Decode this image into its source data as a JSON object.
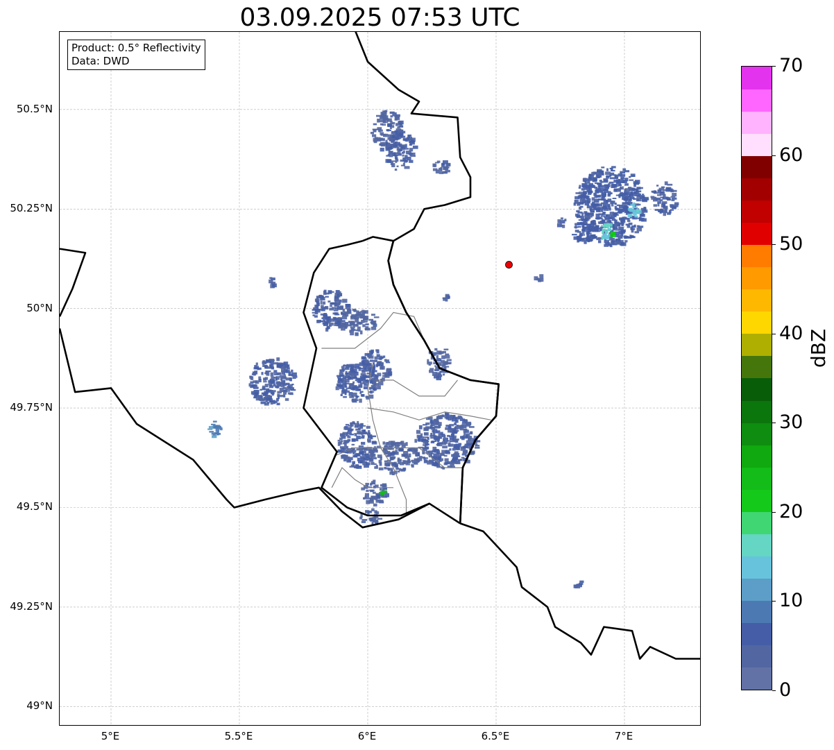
{
  "title": "03.09.2025 07:53 UTC",
  "info": {
    "product": "Product: 0.5° Reflectivity",
    "data": "Data: DWD"
  },
  "map": {
    "lon_range": [
      4.8,
      7.3
    ],
    "lat_range": [
      48.95,
      50.695
    ],
    "lat_ticks": [
      {
        "value": 50.5,
        "label": "50.5°N"
      },
      {
        "value": 50.25,
        "label": "50.25°N"
      },
      {
        "value": 50.0,
        "label": "50°N"
      },
      {
        "value": 49.75,
        "label": "49.75°N"
      },
      {
        "value": 49.5,
        "label": "49.5°N"
      },
      {
        "value": 49.25,
        "label": "49.25°N"
      },
      {
        "value": 49.0,
        "label": "49°N"
      }
    ],
    "lon_ticks": [
      {
        "value": 5.0,
        "label": "5°E"
      },
      {
        "value": 5.5,
        "label": "5.5°E"
      },
      {
        "value": 6.0,
        "label": "6°E"
      },
      {
        "value": 6.5,
        "label": "6.5°E"
      },
      {
        "value": 7.0,
        "label": "7°E"
      }
    ],
    "grid": true,
    "radar_site": {
      "lon": 6.55,
      "lat": 50.11
    },
    "borders": [
      [
        [
          5.95,
          50.7
        ],
        [
          6.0,
          50.62
        ],
        [
          6.12,
          50.55
        ],
        [
          6.2,
          50.52
        ],
        [
          6.17,
          50.49
        ],
        [
          6.35,
          50.48
        ],
        [
          6.36,
          50.38
        ],
        [
          6.4,
          50.33
        ],
        [
          6.4,
          50.28
        ],
        [
          6.3,
          50.26
        ],
        [
          6.22,
          50.25
        ],
        [
          6.18,
          50.2
        ],
        [
          6.1,
          50.17
        ],
        [
          6.08,
          50.12
        ],
        [
          6.1,
          50.06
        ],
        [
          6.15,
          49.99
        ],
        [
          6.22,
          49.92
        ],
        [
          6.28,
          49.85
        ],
        [
          6.4,
          49.82
        ],
        [
          6.51,
          49.81
        ],
        [
          6.5,
          49.73
        ],
        [
          6.42,
          49.67
        ],
        [
          6.37,
          49.6
        ],
        [
          6.36,
          49.46
        ]
      ],
      [
        [
          6.36,
          49.46
        ],
        [
          6.45,
          49.44
        ],
        [
          6.58,
          49.35
        ],
        [
          6.6,
          49.3
        ],
        [
          6.7,
          49.25
        ],
        [
          6.73,
          49.2
        ],
        [
          6.83,
          49.16
        ],
        [
          6.87,
          49.13
        ],
        [
          6.92,
          49.2
        ],
        [
          7.03,
          49.19
        ],
        [
          7.06,
          49.12
        ],
        [
          7.1,
          49.15
        ],
        [
          7.2,
          49.12
        ],
        [
          7.3,
          49.12
        ]
      ],
      [
        [
          6.36,
          49.46
        ],
        [
          6.24,
          49.51
        ],
        [
          6.12,
          49.47
        ],
        [
          5.98,
          49.45
        ],
        [
          5.9,
          49.49
        ],
        [
          5.81,
          49.55
        ],
        [
          5.73,
          49.54
        ],
        [
          5.6,
          49.52
        ],
        [
          5.48,
          49.5
        ],
        [
          5.45,
          49.52
        ],
        [
          5.32,
          49.62
        ],
        [
          5.1,
          49.71
        ],
        [
          5.0,
          49.8
        ],
        [
          4.86,
          49.79
        ],
        [
          4.8,
          49.95
        ]
      ],
      [
        [
          4.8,
          50.15
        ],
        [
          4.9,
          50.14
        ],
        [
          4.85,
          50.05
        ],
        [
          4.8,
          49.98
        ]
      ],
      [
        [
          5.98,
          50.17
        ],
        [
          5.92,
          50.16
        ],
        [
          5.85,
          50.15
        ],
        [
          5.79,
          50.09
        ],
        [
          5.75,
          49.99
        ],
        [
          5.8,
          49.9
        ],
        [
          5.75,
          49.75
        ],
        [
          5.88,
          49.64
        ],
        [
          5.82,
          49.55
        ],
        [
          5.92,
          49.5
        ],
        [
          6.0,
          49.48
        ],
        [
          6.13,
          49.48
        ],
        [
          6.24,
          49.51
        ]
      ],
      [
        [
          6.36,
          49.46
        ],
        [
          6.37,
          49.6
        ],
        [
          6.42,
          49.67
        ],
        [
          6.5,
          49.73
        ],
        [
          6.51,
          49.81
        ],
        [
          6.4,
          49.82
        ],
        [
          6.28,
          49.85
        ],
        [
          6.22,
          49.92
        ],
        [
          6.15,
          49.99
        ],
        [
          6.1,
          50.06
        ],
        [
          6.08,
          50.12
        ],
        [
          6.1,
          50.17
        ],
        [
          6.02,
          50.18
        ],
        [
          5.98,
          50.17
        ]
      ]
    ],
    "admin_lines": [
      [
        [
          5.82,
          49.9
        ],
        [
          5.95,
          49.9
        ],
        [
          6.05,
          49.95
        ],
        [
          6.1,
          49.99
        ],
        [
          6.18,
          49.98
        ],
        [
          6.22,
          49.92
        ]
      ],
      [
        [
          6.03,
          49.82
        ],
        [
          6.1,
          49.82
        ],
        [
          6.2,
          49.78
        ],
        [
          6.3,
          49.78
        ],
        [
          6.35,
          49.82
        ]
      ],
      [
        [
          6.0,
          49.75
        ],
        [
          6.1,
          49.74
        ],
        [
          6.2,
          49.72
        ],
        [
          6.3,
          49.74
        ],
        [
          6.4,
          49.73
        ],
        [
          6.48,
          49.72
        ]
      ],
      [
        [
          6.02,
          49.86
        ],
        [
          6.0,
          49.8
        ],
        [
          6.02,
          49.72
        ],
        [
          6.05,
          49.65
        ],
        [
          6.1,
          49.6
        ],
        [
          6.15,
          49.52
        ],
        [
          6.15,
          49.48
        ]
      ],
      [
        [
          5.87,
          49.63
        ],
        [
          5.95,
          49.65
        ],
        [
          6.05,
          49.65
        ],
        [
          6.2,
          49.65
        ],
        [
          6.3,
          49.6
        ],
        [
          6.37,
          49.6
        ]
      ],
      [
        [
          5.86,
          49.55
        ],
        [
          5.9,
          49.6
        ],
        [
          5.95,
          49.57
        ],
        [
          6.0,
          49.55
        ],
        [
          6.1,
          49.55
        ]
      ]
    ]
  },
  "colorbar": {
    "label": "dBZ",
    "min": 0,
    "max": 70,
    "ticks": [
      0,
      10,
      20,
      30,
      40,
      50,
      60,
      70
    ],
    "tick_labels": [
      "0",
      "10",
      "20",
      "30",
      "40",
      "50",
      "60",
      "70"
    ],
    "colors": [
      "#6272a6",
      "#5266a1",
      "#445da6",
      "#4d79b3",
      "#5c9ec8",
      "#67c3dc",
      "#64d6c3",
      "#3fd673",
      "#14c91a",
      "#13bc18",
      "#10a90f",
      "#0e8d10",
      "#0b760b",
      "#085e08",
      "#45760c",
      "#aeaf00",
      "#ffd700",
      "#ffb800",
      "#ff9a00",
      "#ff7c00",
      "#e10000",
      "#c10000",
      "#a20000",
      "#800000",
      "#ffdefe",
      "#ffb2fe",
      "#ff66ff",
      "#e433ee"
    ]
  },
  "echoes": [
    {
      "lon": 6.07,
      "lat": 50.45,
      "rx": 0.06,
      "ry": 0.05,
      "dbz": 4
    },
    {
      "lon": 6.12,
      "lat": 50.4,
      "rx": 0.06,
      "ry": 0.05,
      "dbz": 5
    },
    {
      "lon": 6.28,
      "lat": 50.36,
      "rx": 0.03,
      "ry": 0.02,
      "dbz": 4
    },
    {
      "lon": 5.85,
      "lat": 50.0,
      "rx": 0.07,
      "ry": 0.05,
      "dbz": 5
    },
    {
      "lon": 5.95,
      "lat": 49.97,
      "rx": 0.08,
      "ry": 0.03,
      "dbz": 4
    },
    {
      "lon": 5.62,
      "lat": 49.82,
      "rx": 0.09,
      "ry": 0.06,
      "dbz": 5
    },
    {
      "lon": 5.95,
      "lat": 49.82,
      "rx": 0.08,
      "ry": 0.05,
      "dbz": 5
    },
    {
      "lon": 6.02,
      "lat": 49.85,
      "rx": 0.06,
      "ry": 0.05,
      "dbz": 5
    },
    {
      "lon": 6.27,
      "lat": 49.87,
      "rx": 0.04,
      "ry": 0.04,
      "dbz": 4
    },
    {
      "lon": 5.95,
      "lat": 49.66,
      "rx": 0.07,
      "ry": 0.06,
      "dbz": 5
    },
    {
      "lon": 6.1,
      "lat": 49.63,
      "rx": 0.1,
      "ry": 0.04,
      "dbz": 4
    },
    {
      "lon": 6.3,
      "lat": 49.67,
      "rx": 0.12,
      "ry": 0.07,
      "dbz": 5
    },
    {
      "lon": 6.02,
      "lat": 49.54,
      "rx": 0.05,
      "ry": 0.03,
      "dbz": 4
    },
    {
      "lon": 6.0,
      "lat": 49.48,
      "rx": 0.04,
      "ry": 0.02,
      "dbz": 4
    },
    {
      "lon": 5.4,
      "lat": 49.7,
      "rx": 0.025,
      "ry": 0.02,
      "dbz": 9
    },
    {
      "lon": 6.94,
      "lat": 50.26,
      "rx": 0.14,
      "ry": 0.1,
      "dbz": 6
    },
    {
      "lon": 6.84,
      "lat": 50.2,
      "rx": 0.05,
      "ry": 0.03,
      "dbz": 6
    },
    {
      "lon": 7.15,
      "lat": 50.28,
      "rx": 0.05,
      "ry": 0.04,
      "dbz": 5
    },
    {
      "lon": 6.92,
      "lat": 50.2,
      "rx": 0.025,
      "ry": 0.02,
      "dbz": 15
    },
    {
      "lon": 7.03,
      "lat": 50.25,
      "rx": 0.025,
      "ry": 0.02,
      "dbz": 14
    },
    {
      "lon": 6.95,
      "lat": 50.19,
      "rx": 0.01,
      "ry": 0.008,
      "dbz": 22
    },
    {
      "lon": 6.05,
      "lat": 49.54,
      "rx": 0.008,
      "ry": 0.004,
      "dbz": 24
    },
    {
      "lon": 6.82,
      "lat": 49.31,
      "rx": 0.02,
      "ry": 0.01,
      "dbz": 5
    },
    {
      "lon": 6.66,
      "lat": 50.08,
      "rx": 0.02,
      "ry": 0.008,
      "dbz": 4
    },
    {
      "lon": 6.3,
      "lat": 50.03,
      "rx": 0.015,
      "ry": 0.01,
      "dbz": 4
    },
    {
      "lon": 5.62,
      "lat": 50.07,
      "rx": 0.012,
      "ry": 0.01,
      "dbz": 4
    },
    {
      "lon": 6.75,
      "lat": 50.22,
      "rx": 0.02,
      "ry": 0.01,
      "dbz": 5
    }
  ]
}
